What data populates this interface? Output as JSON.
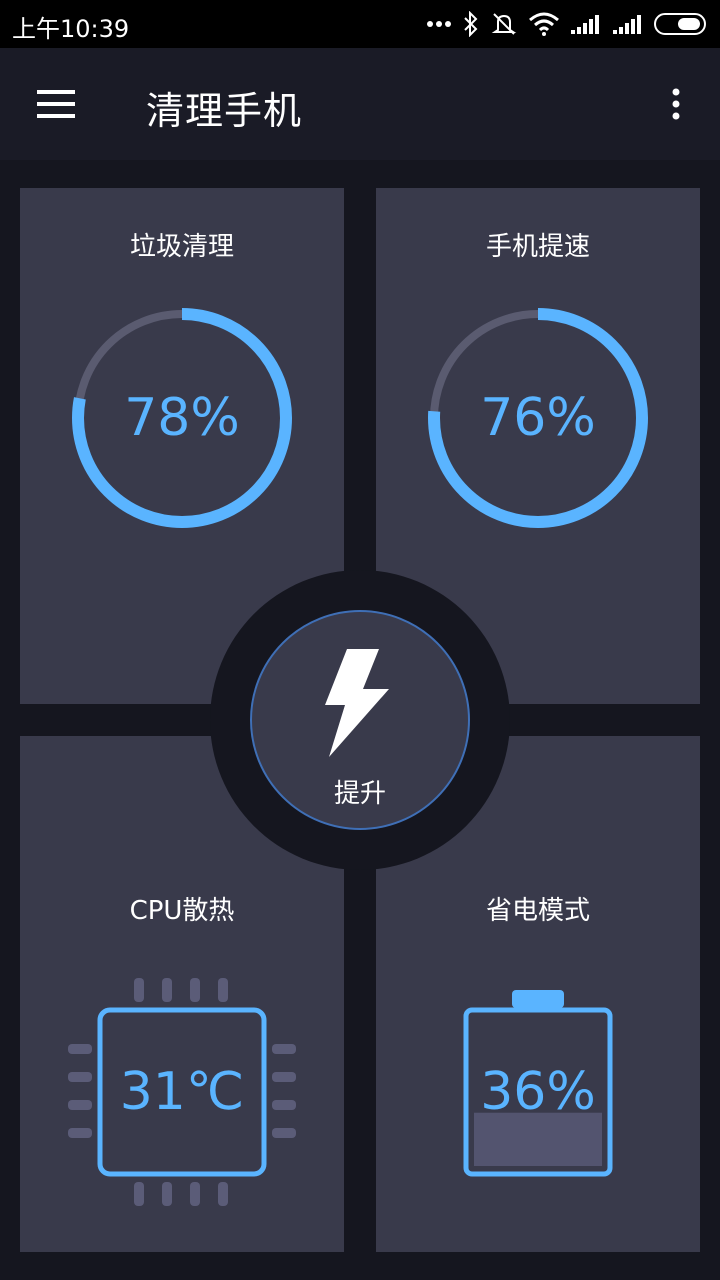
{
  "status_bar": {
    "time": "上午10:39",
    "icons": [
      "more-dots-icon",
      "bluetooth-icon",
      "mute-icon",
      "wifi-icon",
      "signal-icon",
      "signal-icon",
      "battery-icon"
    ]
  },
  "app_bar": {
    "title": "清理手机",
    "menu_icon": "hamburger-menu-icon",
    "overflow_icon": "overflow-menu-icon"
  },
  "cards": {
    "junk": {
      "title": "垃圾清理",
      "value_text": "78%",
      "percent": 78
    },
    "speed": {
      "title": "手机提速",
      "value_text": "76%",
      "percent": 76
    },
    "cpu": {
      "title": "CPU散热",
      "value_text": "31℃"
    },
    "power": {
      "title": "省电模式",
      "value_text": "36%",
      "percent": 36
    }
  },
  "boost": {
    "label": "提升",
    "icon": "lightning-icon"
  },
  "colors": {
    "accent": "#5ab4ff",
    "card": "#393a4b",
    "background": "#15161f",
    "ring_track": "#5a5b70"
  }
}
